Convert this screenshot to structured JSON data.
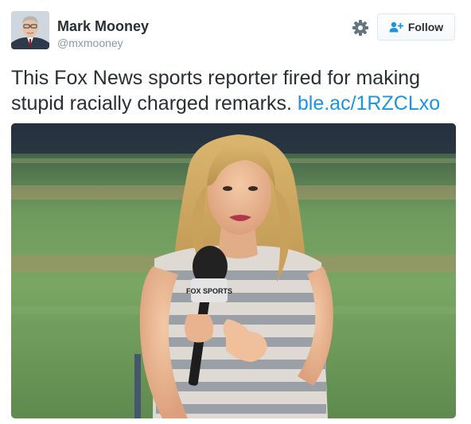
{
  "user": {
    "name": "Mark Mooney",
    "handle": "@mxmooney"
  },
  "actions": {
    "follow_label": "Follow",
    "settings_icon": "gear-icon",
    "follow_icon": "add-user-icon"
  },
  "tweet": {
    "text": "This Fox News sports reporter fired for making stupid racially charged remarks.",
    "link": "ble.ac/1RZCLxo"
  },
  "media": {
    "mic_flag_text": "FOX SPORTS"
  },
  "colors": {
    "link": "#1b95e0",
    "name": "#292f33",
    "handle": "#8899a6"
  }
}
